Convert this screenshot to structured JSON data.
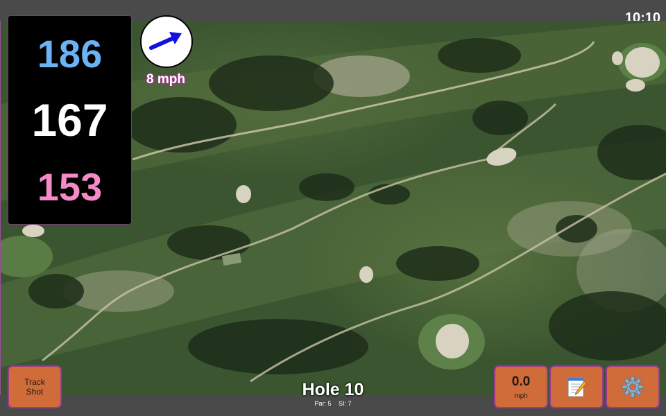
{
  "status": {
    "time": "10:10"
  },
  "distances": {
    "back": "186",
    "middle": "167",
    "front": "153"
  },
  "wind": {
    "speed": "8 mph",
    "icon": "wind-direction-arrow-icon"
  },
  "buttons": {
    "track_shot": "Track\nShot",
    "speed_value": "0.0",
    "speed_unit": "mph",
    "notes_icon": "notepad-icon",
    "settings_icon": "gear-icon"
  },
  "hole": {
    "title": "Hole 10",
    "par": "Par: 5",
    "si": "SI: 7"
  },
  "colors": {
    "back": "#6bb3f5",
    "middle": "#ffffff",
    "front": "#f48bc8",
    "button": "#d06b3a",
    "accent": "#9a3a8e"
  }
}
